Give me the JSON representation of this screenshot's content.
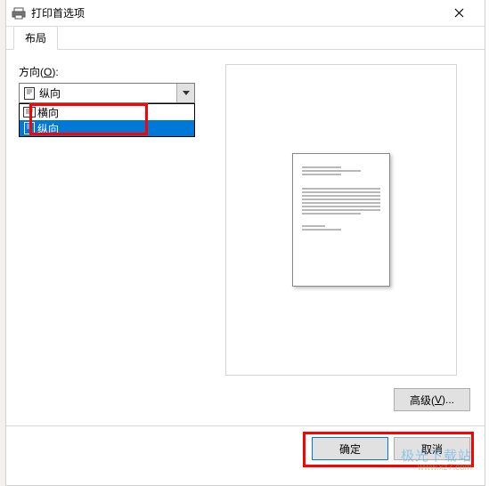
{
  "titlebar": {
    "title": "打印首选项",
    "close": "✕"
  },
  "tabs": {
    "layout": "布局"
  },
  "orientation": {
    "label_prefix": "方向(",
    "label_u": "O",
    "label_suffix": "):",
    "selected": "纵向",
    "options": [
      {
        "label": "横向",
        "selected": false
      },
      {
        "label": "纵向",
        "selected": true
      }
    ]
  },
  "advanced": {
    "label_prefix": "高级(",
    "label_u": "V",
    "label_suffix": ")..."
  },
  "buttons": {
    "ok": "确定",
    "cancel": "取消"
  },
  "watermark": {
    "line1": "极光下载站",
    "line2": "www.xz7.com"
  }
}
